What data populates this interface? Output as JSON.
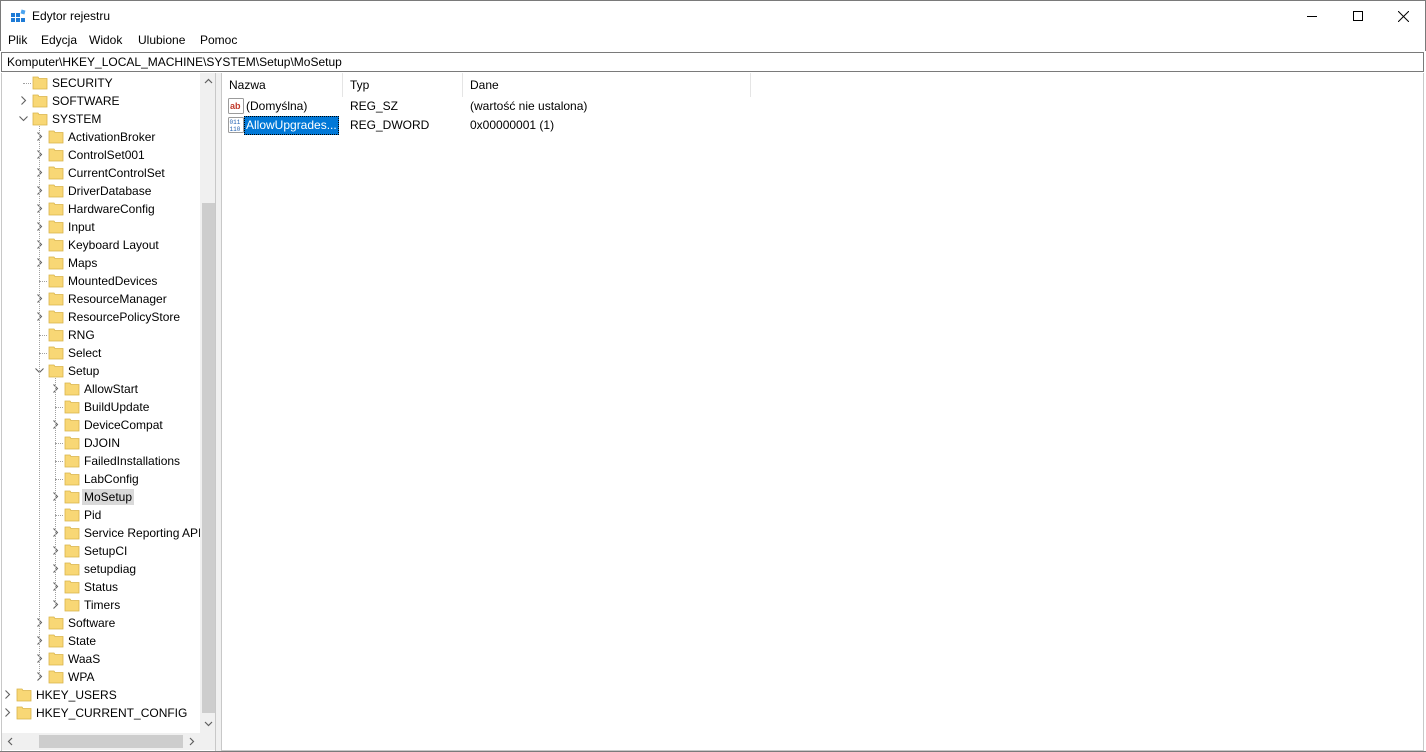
{
  "window": {
    "title": "Edytor rejestru"
  },
  "menu": {
    "items": [
      {
        "label": "Plik"
      },
      {
        "label": "Edycja"
      },
      {
        "label": "Widok"
      },
      {
        "label": "Ulubione"
      },
      {
        "label": "Pomoc"
      }
    ]
  },
  "address": {
    "path": "Komputer\\HKEY_LOCAL_MACHINE\\SYSTEM\\Setup\\MoSetup"
  },
  "tree": {
    "nodes": [
      {
        "label": "SECURITY",
        "level": 1,
        "expander": "none"
      },
      {
        "label": "SOFTWARE",
        "level": 1,
        "expander": "collapsed"
      },
      {
        "label": "SYSTEM",
        "level": 1,
        "expander": "expanded"
      },
      {
        "label": "ActivationBroker",
        "level": 2,
        "expander": "collapsed"
      },
      {
        "label": "ControlSet001",
        "level": 2,
        "expander": "collapsed"
      },
      {
        "label": "CurrentControlSet",
        "level": 2,
        "expander": "collapsed"
      },
      {
        "label": "DriverDatabase",
        "level": 2,
        "expander": "collapsed"
      },
      {
        "label": "HardwareConfig",
        "level": 2,
        "expander": "collapsed"
      },
      {
        "label": "Input",
        "level": 2,
        "expander": "collapsed"
      },
      {
        "label": "Keyboard Layout",
        "level": 2,
        "expander": "collapsed"
      },
      {
        "label": "Maps",
        "level": 2,
        "expander": "collapsed"
      },
      {
        "label": "MountedDevices",
        "level": 2,
        "expander": "none"
      },
      {
        "label": "ResourceManager",
        "level": 2,
        "expander": "collapsed"
      },
      {
        "label": "ResourcePolicyStore",
        "level": 2,
        "expander": "collapsed"
      },
      {
        "label": "RNG",
        "level": 2,
        "expander": "none"
      },
      {
        "label": "Select",
        "level": 2,
        "expander": "none"
      },
      {
        "label": "Setup",
        "level": 2,
        "expander": "expanded"
      },
      {
        "label": "AllowStart",
        "level": 3,
        "expander": "collapsed"
      },
      {
        "label": "BuildUpdate",
        "level": 3,
        "expander": "none"
      },
      {
        "label": "DeviceCompat",
        "level": 3,
        "expander": "collapsed"
      },
      {
        "label": "DJOIN",
        "level": 3,
        "expander": "none"
      },
      {
        "label": "FailedInstallations",
        "level": 3,
        "expander": "none"
      },
      {
        "label": "LabConfig",
        "level": 3,
        "expander": "none"
      },
      {
        "label": "MoSetup",
        "level": 3,
        "expander": "collapsed",
        "selected": true
      },
      {
        "label": "Pid",
        "level": 3,
        "expander": "none"
      },
      {
        "label": "Service Reporting API",
        "level": 3,
        "expander": "collapsed"
      },
      {
        "label": "SetupCI",
        "level": 3,
        "expander": "collapsed"
      },
      {
        "label": "setupdiag",
        "level": 3,
        "expander": "collapsed"
      },
      {
        "label": "Status",
        "level": 3,
        "expander": "collapsed"
      },
      {
        "label": "Timers",
        "level": 3,
        "expander": "collapsed"
      },
      {
        "label": "Software",
        "level": 2,
        "expander": "collapsed"
      },
      {
        "label": "State",
        "level": 2,
        "expander": "collapsed"
      },
      {
        "label": "WaaS",
        "level": 2,
        "expander": "collapsed"
      },
      {
        "label": "WPA",
        "level": 2,
        "expander": "collapsed"
      },
      {
        "label": "HKEY_USERS",
        "level": 0,
        "expander": "collapsed"
      },
      {
        "label": "HKEY_CURRENT_CONFIG",
        "level": 0,
        "expander": "collapsed"
      }
    ]
  },
  "list": {
    "columns": [
      {
        "label": "Nazwa"
      },
      {
        "label": "Typ"
      },
      {
        "label": "Dane"
      }
    ],
    "rows": [
      {
        "name": "(Domyślna)",
        "type": "REG_SZ",
        "data": "(wartość nie ustalona)",
        "icon": "string-value-icon",
        "selected": false
      },
      {
        "name": "AllowUpgrades...",
        "type": "REG_DWORD",
        "data": "0x00000001 (1)",
        "icon": "binary-value-icon",
        "selected": true
      }
    ]
  },
  "colors": {
    "selection": "#0078d7",
    "tree_selection": "#d9d9d9",
    "folder": "#f8d775"
  }
}
